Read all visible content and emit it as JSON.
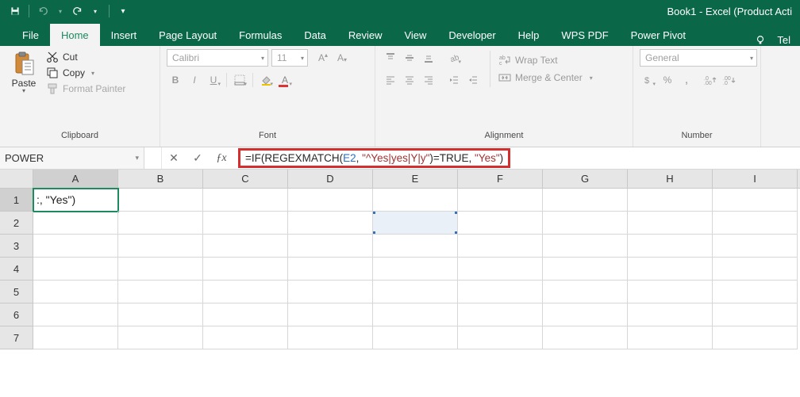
{
  "title": "Book1 - Excel (Product Acti",
  "qat": {
    "save": "save",
    "undo": "undo",
    "redo": "redo"
  },
  "tabs": {
    "file": "File",
    "items": [
      "Home",
      "Insert",
      "Page Layout",
      "Formulas",
      "Data",
      "Review",
      "View",
      "Developer",
      "Help",
      "WPS PDF",
      "Power Pivot"
    ],
    "active": "Home",
    "tell": "Tel"
  },
  "ribbon": {
    "clipboard": {
      "label": "Clipboard",
      "paste": "Paste",
      "cut": "Cut",
      "copy": "Copy",
      "format_painter": "Format Painter"
    },
    "font": {
      "label": "Font",
      "name": "Calibri",
      "size": "11"
    },
    "alignment": {
      "label": "Alignment",
      "wrap": "Wrap Text",
      "merge": "Merge & Center"
    },
    "number": {
      "label": "Number",
      "format": "General"
    }
  },
  "namebox": "POWER",
  "formula": {
    "pre": "=IF(REGEXMATCH(",
    "ref": "E2",
    "mid1": ", ",
    "str1": "\"^Yes|yes|Y|y\"",
    "mid2": ")=TRUE, ",
    "str2": "\"Yes\"",
    "post": ")"
  },
  "columns": [
    "A",
    "B",
    "C",
    "D",
    "E",
    "F",
    "G",
    "H",
    "I"
  ],
  "rows": [
    "1",
    "2",
    "3",
    "4",
    "5",
    "6",
    "7"
  ],
  "cell_a1": ":, \"Yes\")",
  "active_cell": "A1",
  "ref_cell": "E2"
}
